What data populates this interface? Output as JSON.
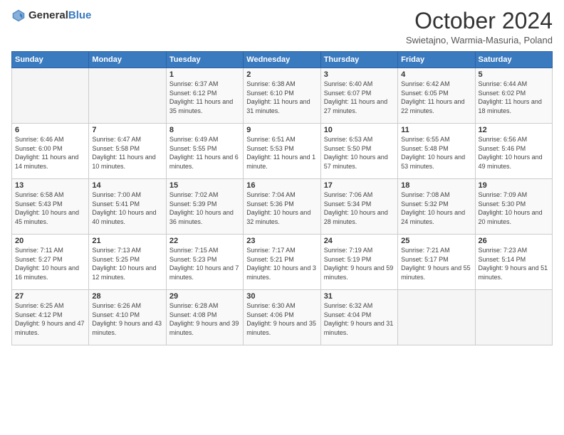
{
  "header": {
    "logo": {
      "general": "General",
      "blue": "Blue"
    },
    "month": "October 2024",
    "location": "Swietajno, Warmia-Masuria, Poland"
  },
  "weekdays": [
    "Sunday",
    "Monday",
    "Tuesday",
    "Wednesday",
    "Thursday",
    "Friday",
    "Saturday"
  ],
  "weeks": [
    [
      {
        "day": null,
        "info": null
      },
      {
        "day": null,
        "info": null
      },
      {
        "day": "1",
        "info": "Sunrise: 6:37 AM\nSunset: 6:12 PM\nDaylight: 11 hours and 35 minutes."
      },
      {
        "day": "2",
        "info": "Sunrise: 6:38 AM\nSunset: 6:10 PM\nDaylight: 11 hours and 31 minutes."
      },
      {
        "day": "3",
        "info": "Sunrise: 6:40 AM\nSunset: 6:07 PM\nDaylight: 11 hours and 27 minutes."
      },
      {
        "day": "4",
        "info": "Sunrise: 6:42 AM\nSunset: 6:05 PM\nDaylight: 11 hours and 22 minutes."
      },
      {
        "day": "5",
        "info": "Sunrise: 6:44 AM\nSunset: 6:02 PM\nDaylight: 11 hours and 18 minutes."
      }
    ],
    [
      {
        "day": "6",
        "info": "Sunrise: 6:46 AM\nSunset: 6:00 PM\nDaylight: 11 hours and 14 minutes."
      },
      {
        "day": "7",
        "info": "Sunrise: 6:47 AM\nSunset: 5:58 PM\nDaylight: 11 hours and 10 minutes."
      },
      {
        "day": "8",
        "info": "Sunrise: 6:49 AM\nSunset: 5:55 PM\nDaylight: 11 hours and 6 minutes."
      },
      {
        "day": "9",
        "info": "Sunrise: 6:51 AM\nSunset: 5:53 PM\nDaylight: 11 hours and 1 minute."
      },
      {
        "day": "10",
        "info": "Sunrise: 6:53 AM\nSunset: 5:50 PM\nDaylight: 10 hours and 57 minutes."
      },
      {
        "day": "11",
        "info": "Sunrise: 6:55 AM\nSunset: 5:48 PM\nDaylight: 10 hours and 53 minutes."
      },
      {
        "day": "12",
        "info": "Sunrise: 6:56 AM\nSunset: 5:46 PM\nDaylight: 10 hours and 49 minutes."
      }
    ],
    [
      {
        "day": "13",
        "info": "Sunrise: 6:58 AM\nSunset: 5:43 PM\nDaylight: 10 hours and 45 minutes."
      },
      {
        "day": "14",
        "info": "Sunrise: 7:00 AM\nSunset: 5:41 PM\nDaylight: 10 hours and 40 minutes."
      },
      {
        "day": "15",
        "info": "Sunrise: 7:02 AM\nSunset: 5:39 PM\nDaylight: 10 hours and 36 minutes."
      },
      {
        "day": "16",
        "info": "Sunrise: 7:04 AM\nSunset: 5:36 PM\nDaylight: 10 hours and 32 minutes."
      },
      {
        "day": "17",
        "info": "Sunrise: 7:06 AM\nSunset: 5:34 PM\nDaylight: 10 hours and 28 minutes."
      },
      {
        "day": "18",
        "info": "Sunrise: 7:08 AM\nSunset: 5:32 PM\nDaylight: 10 hours and 24 minutes."
      },
      {
        "day": "19",
        "info": "Sunrise: 7:09 AM\nSunset: 5:30 PM\nDaylight: 10 hours and 20 minutes."
      }
    ],
    [
      {
        "day": "20",
        "info": "Sunrise: 7:11 AM\nSunset: 5:27 PM\nDaylight: 10 hours and 16 minutes."
      },
      {
        "day": "21",
        "info": "Sunrise: 7:13 AM\nSunset: 5:25 PM\nDaylight: 10 hours and 12 minutes."
      },
      {
        "day": "22",
        "info": "Sunrise: 7:15 AM\nSunset: 5:23 PM\nDaylight: 10 hours and 7 minutes."
      },
      {
        "day": "23",
        "info": "Sunrise: 7:17 AM\nSunset: 5:21 PM\nDaylight: 10 hours and 3 minutes."
      },
      {
        "day": "24",
        "info": "Sunrise: 7:19 AM\nSunset: 5:19 PM\nDaylight: 9 hours and 59 minutes."
      },
      {
        "day": "25",
        "info": "Sunrise: 7:21 AM\nSunset: 5:17 PM\nDaylight: 9 hours and 55 minutes."
      },
      {
        "day": "26",
        "info": "Sunrise: 7:23 AM\nSunset: 5:14 PM\nDaylight: 9 hours and 51 minutes."
      }
    ],
    [
      {
        "day": "27",
        "info": "Sunrise: 6:25 AM\nSunset: 4:12 PM\nDaylight: 9 hours and 47 minutes."
      },
      {
        "day": "28",
        "info": "Sunrise: 6:26 AM\nSunset: 4:10 PM\nDaylight: 9 hours and 43 minutes."
      },
      {
        "day": "29",
        "info": "Sunrise: 6:28 AM\nSunset: 4:08 PM\nDaylight: 9 hours and 39 minutes."
      },
      {
        "day": "30",
        "info": "Sunrise: 6:30 AM\nSunset: 4:06 PM\nDaylight: 9 hours and 35 minutes."
      },
      {
        "day": "31",
        "info": "Sunrise: 6:32 AM\nSunset: 4:04 PM\nDaylight: 9 hours and 31 minutes."
      },
      {
        "day": null,
        "info": null
      },
      {
        "day": null,
        "info": null
      }
    ]
  ]
}
